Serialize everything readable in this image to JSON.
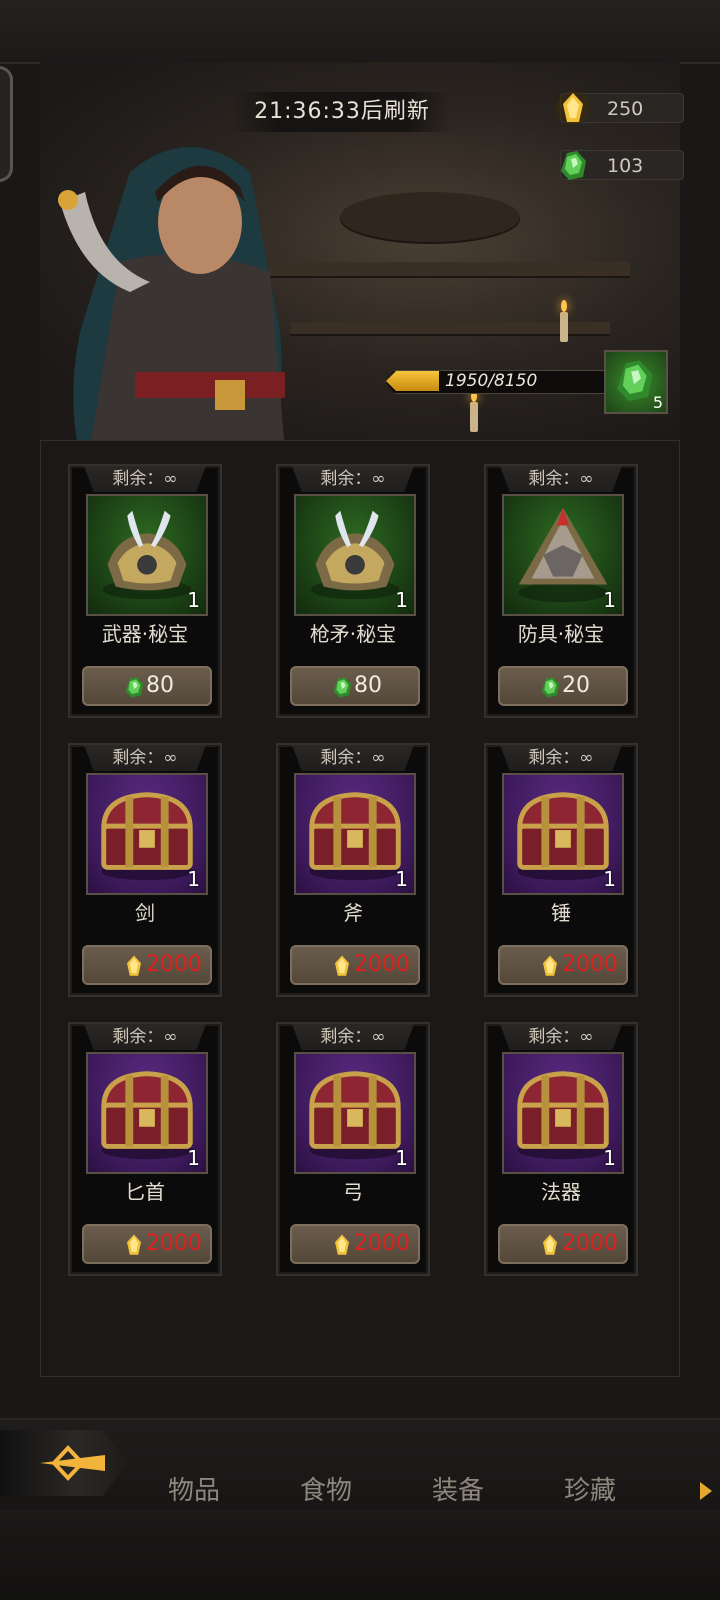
{
  "header": {
    "refresh_timer": "21:36:33后刷新",
    "gold_value": "250",
    "gem_value": "103"
  },
  "progress": {
    "text": "1950/8150",
    "current": 1950,
    "max": 8150,
    "reward_count": "5"
  },
  "shop": {
    "items": [
      {
        "remain": "剩余：∞",
        "name": "武器·秘宝",
        "count": "1",
        "price": "80",
        "currency": "gem-icon",
        "bg": "green"
      },
      {
        "remain": "剩余：∞",
        "name": "枪矛·秘宝",
        "count": "1",
        "price": "80",
        "currency": "gem-icon",
        "bg": "green"
      },
      {
        "remain": "剩余：∞",
        "name": "防具·秘宝",
        "count": "1",
        "price": "20",
        "currency": "gem-icon",
        "bg": "green"
      },
      {
        "remain": "剩余：∞",
        "name": "剑",
        "count": "1",
        "price": "2000",
        "currency": "gold-icon",
        "bg": "purple"
      },
      {
        "remain": "剩余：∞",
        "name": "斧",
        "count": "1",
        "price": "2000",
        "currency": "gold-icon",
        "bg": "purple"
      },
      {
        "remain": "剩余：∞",
        "name": "锤",
        "count": "1",
        "price": "2000",
        "currency": "gold-icon",
        "bg": "purple"
      },
      {
        "remain": "剩余：∞",
        "name": "匕首",
        "count": "1",
        "price": "2000",
        "currency": "gold-icon",
        "bg": "purple"
      },
      {
        "remain": "剩余：∞",
        "name": "弓",
        "count": "1",
        "price": "2000",
        "currency": "gold-icon",
        "bg": "purple"
      },
      {
        "remain": "剩余：∞",
        "name": "法器",
        "count": "1",
        "price": "2000",
        "currency": "gold-icon",
        "bg": "purple"
      }
    ]
  },
  "tabs": [
    {
      "label": "物品"
    },
    {
      "label": "食物"
    },
    {
      "label": "装备"
    },
    {
      "label": "珍藏"
    }
  ],
  "colors": {
    "price_insufficient": "#e01f1f",
    "gold": "#f3c23a",
    "gem": "#3fae3a"
  }
}
